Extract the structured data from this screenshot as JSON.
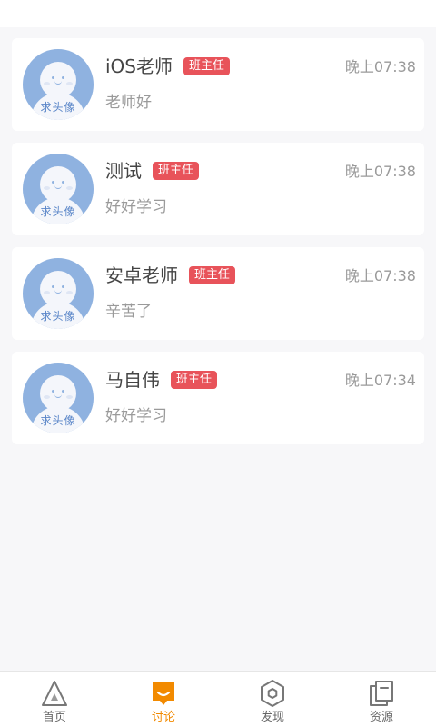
{
  "avatar_text": "求头像",
  "badge_label": "班主任",
  "messages": [
    {
      "name": "iOS老师",
      "badge": "班主任",
      "time": "晚上07:38",
      "preview": "老师好"
    },
    {
      "name": "测试",
      "badge": "班主任",
      "time": "晚上07:38",
      "preview": "好好学习"
    },
    {
      "name": "安卓老师",
      "badge": "班主任",
      "time": "晚上07:38",
      "preview": "辛苦了"
    },
    {
      "name": "马自伟",
      "badge": "班主任",
      "time": "晚上07:34",
      "preview": "好好学习"
    }
  ],
  "tabs": [
    {
      "label": "首页",
      "icon": "triangle-icon",
      "active": false
    },
    {
      "label": "讨论",
      "icon": "chat-bubble-icon",
      "active": true
    },
    {
      "label": "发现",
      "icon": "hexagon-icon",
      "active": false
    },
    {
      "label": "资源",
      "icon": "documents-icon",
      "active": false
    }
  ],
  "colors": {
    "accent": "#f28a00",
    "badge": "#e8535a",
    "avatar": "#8fb2e0",
    "background": "#f7f7f9"
  }
}
